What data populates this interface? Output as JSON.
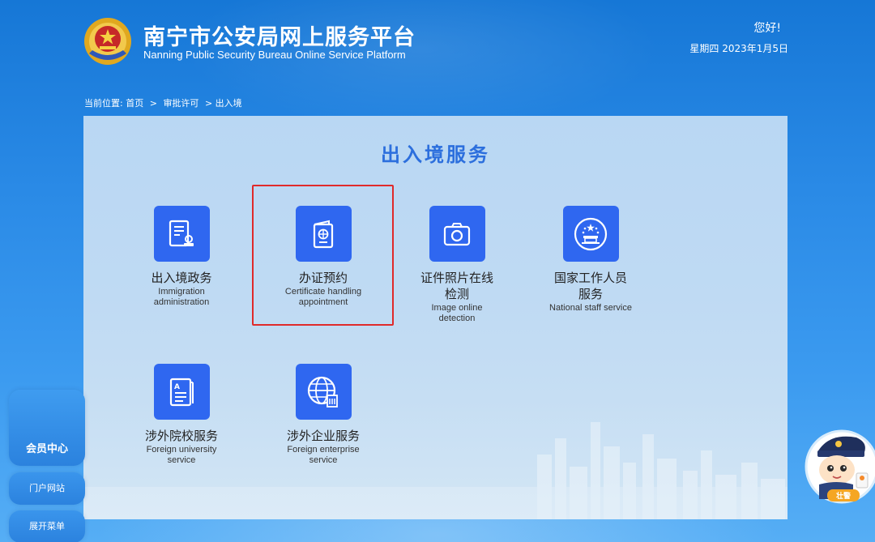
{
  "header": {
    "title_cn": "南宁市公安局网上服务平台",
    "title_en": "Nanning Public Security Bureau Online Service Platform",
    "greeting": "您好!",
    "date": "星期四 2023年1月5日",
    "emblem_icon": "police-emblem-icon"
  },
  "breadcrumb": {
    "prefix": "当前位置:",
    "items": [
      "首页",
      "审批许可",
      "出入境"
    ],
    "separator": ">"
  },
  "panel": {
    "title": "出入境服务",
    "tiles": [
      {
        "cn": "出入境政务",
        "en_line1": "Immigration",
        "en_line2": "administration",
        "icon": "document-stamp-icon"
      },
      {
        "cn": "办证预约",
        "en_line1": "Certificate handling",
        "en_line2": "appointment",
        "icon": "passport-icon"
      },
      {
        "cn_line1": "证件照片在线",
        "cn_line2": "检测",
        "en_line1": "Image online",
        "en_line2": "detection",
        "icon": "camera-icon"
      },
      {
        "cn_line1": "国家工作人员",
        "cn_line2": "服务",
        "en_line1": "National staff service",
        "icon": "national-emblem-icon"
      },
      {
        "cn": "涉外院校服务",
        "en_line1": "Foreign university",
        "en_line2": "service",
        "icon": "book-icon"
      },
      {
        "cn": "涉外企业服务",
        "en_line1": "Foreign enterprise",
        "en_line2": "service",
        "icon": "globe-building-icon"
      }
    ]
  },
  "sidebar": {
    "member": "会员中心",
    "portal": "门户网站",
    "menu": "展开菜单"
  },
  "mascot": {
    "label": "壮警"
  },
  "colors": {
    "accent": "#2f67f0",
    "title": "#2c6fdd",
    "highlight": "#e02a2a",
    "background": "#2a8ae6"
  }
}
